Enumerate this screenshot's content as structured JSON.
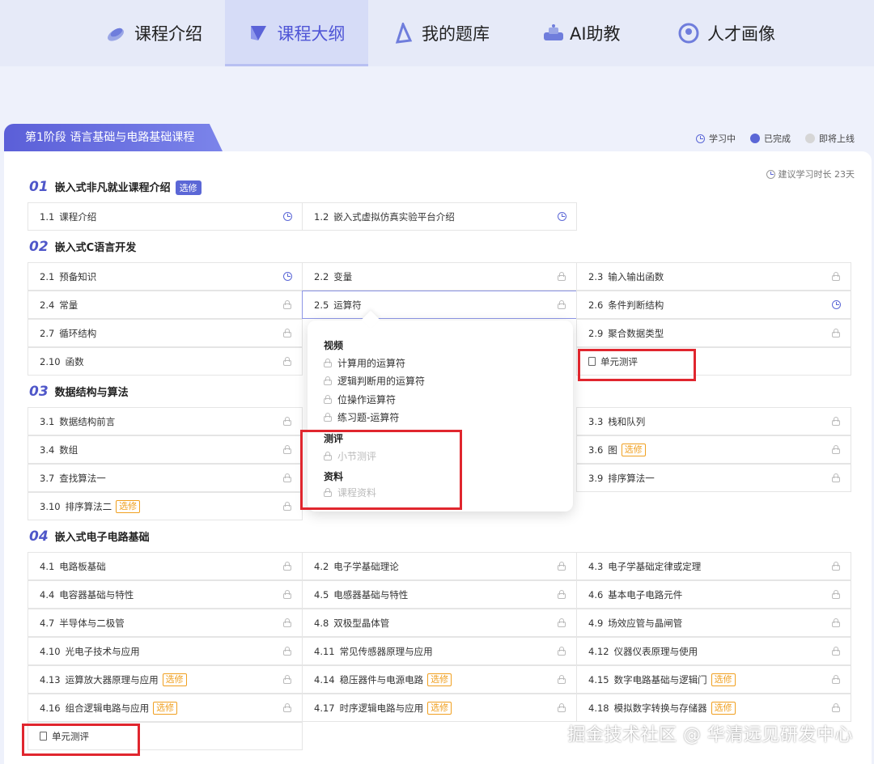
{
  "nav": {
    "tabs": [
      {
        "label": "课程介绍",
        "icon": "course-intro-icon"
      },
      {
        "label": "课程大纲",
        "icon": "course-outline-icon",
        "active": true
      },
      {
        "label": "我的题库",
        "icon": "question-bank-icon"
      },
      {
        "label": "AI助教",
        "icon": "ai-assistant-icon"
      },
      {
        "label": "人才画像",
        "icon": "talent-profile-icon"
      }
    ]
  },
  "stage": {
    "title": "第1阶段 语言基础与电路基础课程"
  },
  "legend": {
    "learning": "学习中",
    "done": "已完成",
    "soon": "即将上线"
  },
  "suggest": "建议学习时长 23天",
  "tags": {
    "required": "选修",
    "elective": "选修"
  },
  "sections": [
    {
      "num": "01",
      "title": "嵌入式非凡就业课程介绍"
    },
    {
      "num": "02",
      "title": "嵌入式C语言开发"
    },
    {
      "num": "03",
      "title": "数据结构与算法"
    },
    {
      "num": "04",
      "title": "嵌入式电子电路基础"
    }
  ],
  "lessons": {
    "s1": [
      {
        "num": "1.1",
        "name": "课程介绍"
      },
      {
        "num": "1.2",
        "name": "嵌入式虚拟仿真实验平台介绍"
      }
    ],
    "s2": [
      {
        "num": "2.1",
        "name": "预备知识"
      },
      {
        "num": "2.2",
        "name": "变量"
      },
      {
        "num": "2.3",
        "name": "输入输出函数"
      },
      {
        "num": "2.4",
        "name": "常量"
      },
      {
        "num": "2.5",
        "name": "运算符"
      },
      {
        "num": "2.6",
        "name": "条件判断结构"
      },
      {
        "num": "2.7",
        "name": "循环结构"
      },
      {
        "num": "2.9",
        "name": "聚合数据类型"
      },
      {
        "num": "2.10",
        "name": "函数"
      },
      {
        "num": "",
        "name": "单元测评"
      }
    ],
    "s3": [
      {
        "num": "3.1",
        "name": "数据结构前言"
      },
      {
        "num": "3.3",
        "name": "栈和队列"
      },
      {
        "num": "3.4",
        "name": "数组"
      },
      {
        "num": "3.6",
        "name": "图"
      },
      {
        "num": "3.7",
        "name": "查找算法一"
      },
      {
        "num": "3.9",
        "name": "排序算法一"
      },
      {
        "num": "3.10",
        "name": "排序算法二"
      }
    ],
    "s4": [
      {
        "num": "4.1",
        "name": "电路板基础"
      },
      {
        "num": "4.2",
        "name": "电子学基础理论"
      },
      {
        "num": "4.3",
        "name": "电子学基础定律或定理"
      },
      {
        "num": "4.4",
        "name": "电容器基础与特性"
      },
      {
        "num": "4.5",
        "name": "电感器基础与特性"
      },
      {
        "num": "4.6",
        "name": "基本电子电路元件"
      },
      {
        "num": "4.7",
        "name": "半导体与二极管"
      },
      {
        "num": "4.8",
        "name": "双极型晶体管"
      },
      {
        "num": "4.9",
        "name": "场效应管与晶闸管"
      },
      {
        "num": "4.10",
        "name": "光电子技术与应用"
      },
      {
        "num": "4.11",
        "name": "常见传感器原理与应用"
      },
      {
        "num": "4.12",
        "name": "仪器仪表原理与使用"
      },
      {
        "num": "4.13",
        "name": "运算放大器原理与应用"
      },
      {
        "num": "4.14",
        "name": "稳压器件与电源电路"
      },
      {
        "num": "4.15",
        "name": "数字电路基础与逻辑门"
      },
      {
        "num": "4.16",
        "name": "组合逻辑电路与应用"
      },
      {
        "num": "4.17",
        "name": "时序逻辑电路与应用"
      },
      {
        "num": "4.18",
        "name": "模拟数字转换与存储器"
      },
      {
        "num": "",
        "name": "单元测评"
      }
    ]
  },
  "popover": {
    "video_head": "视频",
    "videos": [
      "计算用的运算符",
      "逻辑判断用的运算符",
      "位操作运算符",
      "练习题-运算符"
    ],
    "eval_head": "测评",
    "eval_item": "小节测评",
    "material_head": "资料",
    "material_item": "课程资料"
  },
  "watermark": "掘金技术社区 @ 华清远见研发中心",
  "colors": {
    "accent": "#5b67d6",
    "elective": "#f0a020",
    "highlight_box": "#e0262e"
  }
}
